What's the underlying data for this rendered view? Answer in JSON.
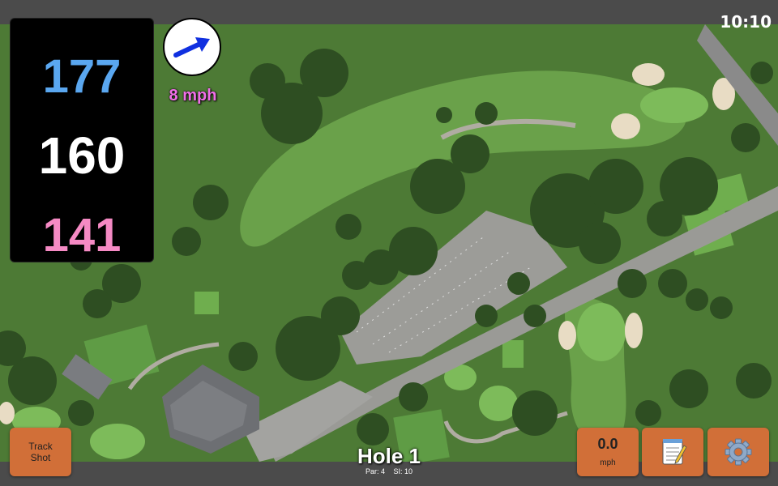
{
  "clock": "10:10",
  "distances": {
    "back": "177",
    "middle": "160",
    "front": "141"
  },
  "wind": {
    "speed_label": "8 mph"
  },
  "hole": {
    "title": "Hole 1",
    "par": "Par: 4",
    "si": "SI: 10"
  },
  "buttons": {
    "track_shot_line1": "Track",
    "track_shot_line2": "Shot",
    "wind_value": "0.0",
    "wind_unit": "mph",
    "notes_icon": "notepad-icon",
    "settings_icon": "gear-icon"
  },
  "colors": {
    "back": "#5aa7f0",
    "middle": "#ffffff",
    "front": "#f58ac4",
    "wind_label": "#f06ee8",
    "button": "#d16f38"
  }
}
